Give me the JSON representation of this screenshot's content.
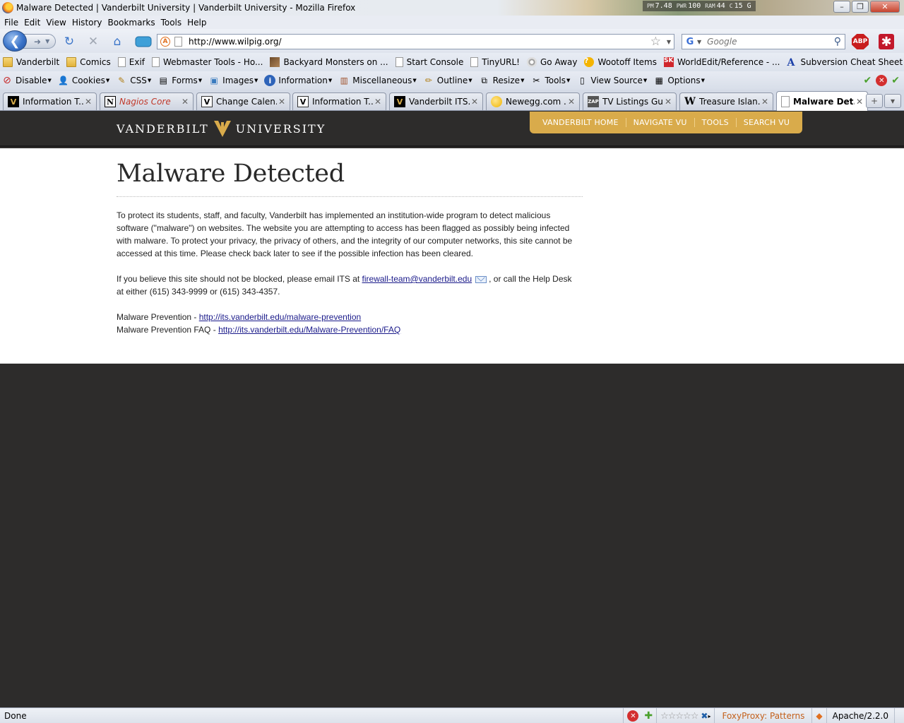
{
  "window": {
    "title": "Malware Detected | Vanderbilt University | Vanderbilt University - Mozilla Firefox",
    "sysmon": [
      {
        "key": "PM",
        "val": "7.48"
      },
      {
        "key": "PWR",
        "val": "100"
      },
      {
        "key": "RAM",
        "val": "44"
      },
      {
        "key": "C",
        "val": "15 G"
      }
    ],
    "buttons": {
      "minimize": "–",
      "maximize": "❐",
      "close": "✕"
    }
  },
  "menu": [
    "File",
    "Edit",
    "View",
    "History",
    "Bookmarks",
    "Tools",
    "Help"
  ],
  "nav": {
    "url": "http://www.wilpig.org/",
    "search_placeholder": "Google",
    "abp_label": "ABP"
  },
  "bookmarks": [
    {
      "label": "Vanderbilt",
      "icon": "folder-icon"
    },
    {
      "label": "Comics",
      "icon": "folder-icon"
    },
    {
      "label": "Exif",
      "icon": "page-icon"
    },
    {
      "label": "Webmaster Tools - Ho...",
      "icon": "page-icon"
    },
    {
      "label": "Backyard Monsters on ...",
      "icon": "game-icon"
    },
    {
      "label": "Start Console",
      "icon": "page-icon"
    },
    {
      "label": "TinyURL!",
      "icon": "page-icon"
    },
    {
      "label": "Go Away",
      "icon": "swirl-icon"
    },
    {
      "label": "Wootoff Items",
      "icon": "question-icon"
    },
    {
      "label": "WorldEdit/Reference - ...",
      "icon": "sk-icon"
    },
    {
      "label": "Subversion Cheat Sheet",
      "icon": "a-icon"
    }
  ],
  "devtoolbar": [
    "Disable",
    "Cookies",
    "CSS",
    "Forms",
    "Images",
    "Information",
    "Miscellaneous",
    "Outline",
    "Resize",
    "Tools",
    "View Source",
    "Options"
  ],
  "tabs": [
    {
      "label": "Information T...",
      "favicon": "vanderbilt-icon",
      "active": false
    },
    {
      "label": "Nagios Core",
      "favicon": "nagios-icon",
      "active": false
    },
    {
      "label": "Change Calen...",
      "favicon": "vu-page-icon",
      "active": false
    },
    {
      "label": "Information T...",
      "favicon": "vu-page-icon",
      "active": false
    },
    {
      "label": "Vanderbilt ITS...",
      "favicon": "vanderbilt-icon",
      "active": false
    },
    {
      "label": "Newegg.com ...",
      "favicon": "newegg-icon",
      "active": false
    },
    {
      "label": "TV Listings Gu...",
      "favicon": "zap2it-icon",
      "active": false
    },
    {
      "label": "Treasure Islan...",
      "favicon": "wikipedia-icon",
      "active": false
    },
    {
      "label": "Malware Det...",
      "favicon": "page-icon",
      "active": true
    }
  ],
  "vu": {
    "logo_left": "VANDERBILT",
    "logo_right": "UNIVERSITY",
    "nav": [
      "VANDERBILT HOME",
      "NAVIGATE VU",
      "TOOLS",
      "SEARCH VU"
    ]
  },
  "content": {
    "heading": "Malware Detected",
    "para1": "To protect its students, staff, and faculty, Vanderbilt has implemented an institution-wide program to detect malicious software (\"malware\") on websites. The website you are attempting to access has been flagged as possibly being infected with malware. To protect your privacy, the privacy of others, and the integrity of our computer networks, this site cannot be accessed at this time. Please check back later to see if the possible infection has been cleared.",
    "para2_before": "If you believe this site should not be blocked, please email ITS at ",
    "email": "firewall-team@vanderbilt.edu",
    "para2_after": ", or call the Help Desk at either (615) 343-9999 or (615) 343-4357.",
    "link1_prefix": "Malware Prevention - ",
    "link1": "http://its.vanderbilt.edu/malware-prevention",
    "link2_prefix": "Malware Prevention FAQ - ",
    "link2": "http://its.vanderbilt.edu/Malware-Prevention/FAQ"
  },
  "status": {
    "text": "Done",
    "foxyproxy": "FoxyProxy: Patterns",
    "server": "Apache/2.2.0",
    "rating_stars": 0
  }
}
